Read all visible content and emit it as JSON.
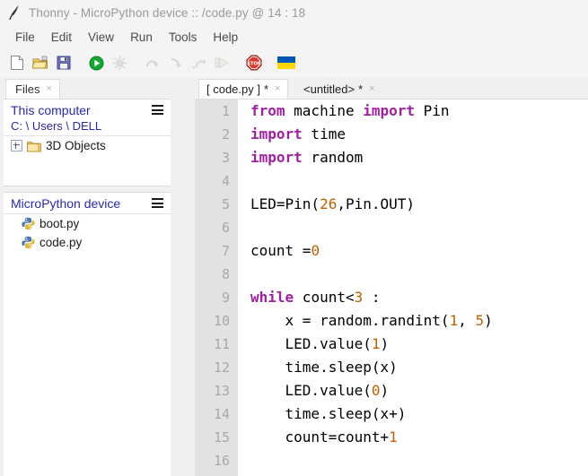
{
  "window": {
    "title": "Thonny  -  MicroPython device :: /code.py  @  14 : 18",
    "app_icon": "feather-quill-icon"
  },
  "menu": {
    "items": [
      {
        "label": "File"
      },
      {
        "label": "Edit"
      },
      {
        "label": "View"
      },
      {
        "label": "Run"
      },
      {
        "label": "Tools"
      },
      {
        "label": "Help"
      }
    ]
  },
  "toolbar": {
    "buttons": [
      {
        "name": "new-file-icon",
        "title": "New"
      },
      {
        "name": "open-file-icon",
        "title": "Load"
      },
      {
        "name": "save-file-icon",
        "title": "Save"
      },
      {
        "name": "run-icon",
        "title": "Run current script"
      },
      {
        "name": "debug-icon",
        "title": "Debug current script"
      },
      {
        "name": "step-over-icon",
        "title": "Step over"
      },
      {
        "name": "step-into-icon",
        "title": "Step into"
      },
      {
        "name": "step-out-icon",
        "title": "Step out"
      },
      {
        "name": "resume-icon",
        "title": "Resume"
      },
      {
        "name": "stop-icon",
        "title": "Stop/Restart backend"
      },
      {
        "name": "ukraine-flag-icon",
        "title": "Support Ukraine"
      }
    ]
  },
  "files_panel": {
    "tab_label": "Files",
    "tab_close": "×",
    "sections": [
      {
        "title": "This computer",
        "path": "C: \\ Users \\ DELL",
        "menu_icon": "hamburger-icon",
        "entries": [
          {
            "label": "3D Objects",
            "icon": "folder-icon",
            "expandable": true
          }
        ]
      },
      {
        "title": "MicroPython device",
        "path": "",
        "menu_icon": "hamburger-icon",
        "entries": [
          {
            "label": "boot.py",
            "icon": "python-file-icon",
            "expandable": false
          },
          {
            "label": "code.py",
            "icon": "python-file-icon",
            "expandable": false
          }
        ]
      }
    ]
  },
  "editor": {
    "tabs": [
      {
        "label": "[ code.py ]",
        "dirty": "*",
        "close": "×",
        "active": true
      },
      {
        "label": "<untitled>",
        "dirty": "*",
        "close": "×",
        "active": false
      }
    ],
    "line_numbers": [
      "1",
      "2",
      "3",
      "4",
      "5",
      "6",
      "7",
      "8",
      "9",
      "10",
      "11",
      "12",
      "13",
      "14",
      "15",
      "16"
    ],
    "code": [
      {
        "n": "1",
        "tokens": [
          {
            "t": "kw",
            "v": "from"
          },
          {
            "t": "p",
            "v": " machine "
          },
          {
            "t": "kw",
            "v": "import"
          },
          {
            "t": "p",
            "v": " Pin"
          }
        ]
      },
      {
        "n": "2",
        "tokens": [
          {
            "t": "kw",
            "v": "import"
          },
          {
            "t": "p",
            "v": " time"
          }
        ]
      },
      {
        "n": "3",
        "tokens": [
          {
            "t": "kw",
            "v": "import"
          },
          {
            "t": "p",
            "v": " random"
          }
        ]
      },
      {
        "n": "4",
        "tokens": []
      },
      {
        "n": "5",
        "tokens": [
          {
            "t": "p",
            "v": "LED=Pin("
          },
          {
            "t": "num",
            "v": "26"
          },
          {
            "t": "p",
            "v": ",Pin.OUT)"
          }
        ]
      },
      {
        "n": "6",
        "tokens": []
      },
      {
        "n": "7",
        "tokens": [
          {
            "t": "p",
            "v": "count ="
          },
          {
            "t": "num",
            "v": "0"
          }
        ]
      },
      {
        "n": "8",
        "tokens": []
      },
      {
        "n": "9",
        "tokens": [
          {
            "t": "kw",
            "v": "while"
          },
          {
            "t": "p",
            "v": " count<"
          },
          {
            "t": "num",
            "v": "3"
          },
          {
            "t": "p",
            "v": " :"
          }
        ]
      },
      {
        "n": "10",
        "tokens": [
          {
            "t": "p",
            "v": "    x = random.randint("
          },
          {
            "t": "num",
            "v": "1"
          },
          {
            "t": "p",
            "v": ", "
          },
          {
            "t": "num",
            "v": "5"
          },
          {
            "t": "p",
            "v": ")"
          }
        ]
      },
      {
        "n": "11",
        "tokens": [
          {
            "t": "p",
            "v": "    LED.value("
          },
          {
            "t": "num",
            "v": "1"
          },
          {
            "t": "p",
            "v": ")"
          }
        ]
      },
      {
        "n": "12",
        "tokens": [
          {
            "t": "p",
            "v": "    time.sleep(x)"
          }
        ]
      },
      {
        "n": "13",
        "tokens": [
          {
            "t": "p",
            "v": "    LED.value("
          },
          {
            "t": "num",
            "v": "0"
          },
          {
            "t": "p",
            "v": ")"
          }
        ]
      },
      {
        "n": "14",
        "tokens": [
          {
            "t": "p",
            "v": "    time.sleep(x+)"
          }
        ]
      },
      {
        "n": "15",
        "tokens": [
          {
            "t": "p",
            "v": "    count=count+"
          },
          {
            "t": "num",
            "v": "1"
          }
        ]
      },
      {
        "n": "16",
        "tokens": []
      }
    ]
  },
  "colors": {
    "keyword": "#a020a0",
    "number": "#c06000",
    "plain": "#000000",
    "panel_link": "#2a2aa5",
    "gutter_bg": "#e2e2e2",
    "gutter_fg": "#a8a8a8",
    "chrome_bg": "#f4f4f4",
    "title_fg": "#9a9a9a"
  }
}
